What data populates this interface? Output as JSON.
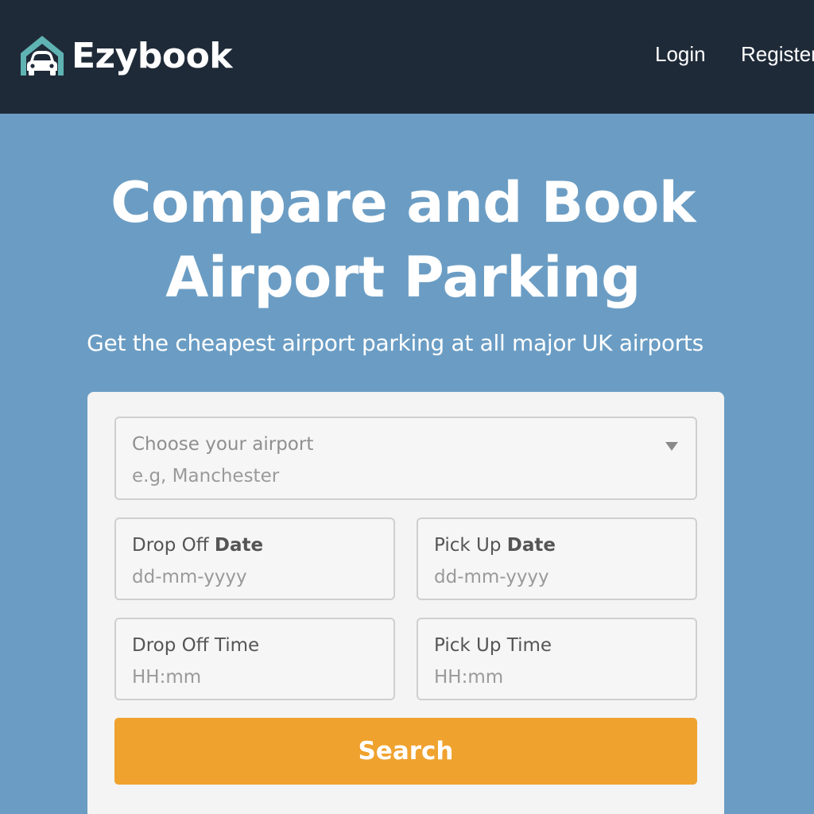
{
  "header": {
    "brand_name": "Ezybook",
    "logo_icon": "garage-car-icon",
    "nav": {
      "login": "Login",
      "register": "Register"
    }
  },
  "hero": {
    "title_line1": "Compare and Book",
    "title_line2": "Airport Parking",
    "subtitle": "Get the cheapest airport parking at all major UK airports"
  },
  "form": {
    "airport": {
      "label": "Choose your airport",
      "placeholder": "e.g, Manchester",
      "icon": "chevron-down-icon"
    },
    "dropoff_date": {
      "label_prefix": "Drop Off ",
      "label_bold": "Date",
      "placeholder": "dd-mm-yyyy"
    },
    "pickup_date": {
      "label_prefix": "Pick Up ",
      "label_bold": "Date",
      "placeholder": "dd-mm-yyyy"
    },
    "dropoff_time": {
      "label": "Drop Off Time",
      "placeholder": "HH:mm"
    },
    "pickup_time": {
      "label": "Pick Up Time",
      "placeholder": "HH:mm"
    },
    "search_label": "Search"
  },
  "colors": {
    "navbar_bg": "#1f2a38",
    "page_bg": "#6b9dc4",
    "logo_accent": "#5fb3b3",
    "button_bg": "#f0a22e",
    "card_bg": "#f4f4f4"
  }
}
